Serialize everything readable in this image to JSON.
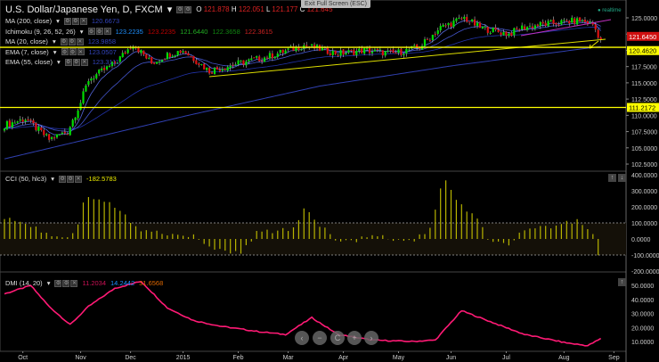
{
  "header": {
    "title": "U.S. Dollar/Japanese Yen, D, FXCM",
    "o_label": "O",
    "o": "121.878",
    "h_label": "H",
    "h": "122.051",
    "l_label": "L",
    "l": "121.177",
    "c_label": "C",
    "c": "121.645",
    "exit_fullscreen": "Exit Full Screen (ESC)",
    "realtime": "realtime"
  },
  "indicators": [
    {
      "name": "MA (200, close)",
      "values": [
        "120.6673"
      ],
      "colors": [
        "#3344bb"
      ]
    },
    {
      "name": "Ichimoku (9, 26, 52, 26)",
      "values": [
        "123.2235",
        "123.2235",
        "121.6440",
        "122.3658",
        "122.3615"
      ],
      "colors": [
        "#1e90ff",
        "#c00000",
        "#22aa22",
        "#118811",
        "#cc2222"
      ]
    },
    {
      "name": "MA (20, close)",
      "values": [
        "123.9858"
      ],
      "colors": [
        "#3344bb"
      ]
    },
    {
      "name": "EMA (7, close)",
      "values": [
        "123.0507"
      ],
      "colors": [
        "#3344bb"
      ]
    },
    {
      "name": "EMA (55, close)",
      "values": [
        "123.3111"
      ],
      "colors": [
        "#3344bb"
      ]
    }
  ],
  "cci": {
    "name": "CCI (50, hlc3)",
    "value": "-182.5783"
  },
  "dmi": {
    "name": "DMI (14, 20)",
    "values": [
      "11.2034",
      "14.2442",
      "31.6568"
    ],
    "colors": [
      "#cc1155",
      "#1e90ff",
      "#dd6600"
    ]
  },
  "price_badges": {
    "last": "121.6450",
    "line1": "120.4620",
    "line2": "111.2172"
  },
  "nav": {
    "left": "‹",
    "zoom_out": "−",
    "reset": "C",
    "zoom_in": "+",
    "right": "›"
  },
  "colors": {
    "up": "#00dd00",
    "down": "#dd1111",
    "hline": "#ffff00",
    "cci": "#b8b400",
    "dmi": "#ff1a75"
  },
  "chart_data": [
    {
      "type": "candlestick",
      "title": "U.S. Dollar/Japanese Yen, D, FXCM",
      "bars": 228,
      "price_axis_ticks": [
        "125.0000",
        "122.5000",
        "120.0000",
        "117.5000",
        "115.0000",
        "112.5000",
        "110.0000",
        "107.5000",
        "105.0000",
        "102.5000"
      ],
      "ylim": [
        101.5,
        126.5
      ],
      "close_path": [
        [
          0,
          108.5
        ],
        [
          8,
          109.5
        ],
        [
          17,
          106.3
        ],
        [
          24,
          107.5
        ],
        [
          29,
          112
        ],
        [
          32,
          115.5
        ],
        [
          42,
          118
        ],
        [
          49,
          121
        ],
        [
          56,
          118
        ],
        [
          63,
          119.5
        ],
        [
          68,
          120
        ],
        [
          78,
          116.8
        ],
        [
          89,
          118
        ],
        [
          100,
          119
        ],
        [
          114,
          120.8
        ],
        [
          127,
          119.5
        ],
        [
          137,
          120
        ],
        [
          148,
          119.5
        ],
        [
          158,
          120.5
        ],
        [
          166,
          123.5
        ],
        [
          175,
          125
        ],
        [
          181,
          123.5
        ],
        [
          192,
          122.5
        ],
        [
          197,
          123.5
        ],
        [
          205,
          124
        ],
        [
          219,
          124.6
        ],
        [
          224,
          124
        ],
        [
          227,
          121.6
        ]
      ],
      "ma200_path": [
        [
          0,
          103.3
        ],
        [
          70,
          110
        ],
        [
          120,
          114.5
        ],
        [
          170,
          117.6
        ],
        [
          227,
          120.6
        ]
      ],
      "horizontal_lines": [
        120.462,
        111.2172
      ]
    },
    {
      "type": "bar",
      "title": "CCI (50, hlc3)",
      "axis_ticks": [
        "400.0000",
        "300.0000",
        "200.0000",
        "100.0000",
        "0.0000",
        "-100.0000",
        "-200.0000"
      ],
      "ylim": [
        -220,
        410
      ],
      "path": [
        [
          0,
          130
        ],
        [
          8,
          100
        ],
        [
          18,
          20
        ],
        [
          25,
          20
        ],
        [
          28,
          100
        ],
        [
          31,
          280
        ],
        [
          40,
          220
        ],
        [
          52,
          60
        ],
        [
          60,
          40
        ],
        [
          74,
          10
        ],
        [
          78,
          -60
        ],
        [
          90,
          -90
        ],
        [
          96,
          40
        ],
        [
          110,
          60
        ],
        [
          114,
          200
        ],
        [
          118,
          120
        ],
        [
          128,
          -30
        ],
        [
          140,
          20
        ],
        [
          155,
          -20
        ],
        [
          162,
          60
        ],
        [
          166,
          300
        ],
        [
          167,
          380
        ],
        [
          172,
          250
        ],
        [
          181,
          100
        ],
        [
          184,
          0
        ],
        [
          192,
          -40
        ],
        [
          197,
          50
        ],
        [
          210,
          80
        ],
        [
          218,
          120
        ],
        [
          224,
          30
        ],
        [
          226,
          -100
        ],
        [
          227,
          -182
        ]
      ]
    },
    {
      "type": "line",
      "title": "DMI (14, 20)",
      "axis_ticks": [
        "50.0000",
        "40.0000",
        "30.0000",
        "20.0000",
        "10.0000"
      ],
      "ylim": [
        2,
        55
      ],
      "path": [
        [
          0,
          44
        ],
        [
          10,
          50
        ],
        [
          17,
          35
        ],
        [
          25,
          22
        ],
        [
          32,
          35
        ],
        [
          42,
          48
        ],
        [
          52,
          53
        ],
        [
          62,
          34
        ],
        [
          72,
          25
        ],
        [
          82,
          21
        ],
        [
          97,
          17
        ],
        [
          107,
          15
        ],
        [
          117,
          27
        ],
        [
          127,
          15
        ],
        [
          140,
          11
        ],
        [
          155,
          10
        ],
        [
          164,
          11
        ],
        [
          174,
          32
        ],
        [
          188,
          22
        ],
        [
          198,
          15
        ],
        [
          214,
          9
        ],
        [
          222,
          7
        ],
        [
          227,
          12
        ]
      ]
    },
    {
      "type": "x-axis",
      "labels": [
        "Oct",
        "Nov",
        "Dec",
        "2015",
        "Feb",
        "Mar",
        "Apr",
        "May",
        "Jun",
        "Jul",
        "Aug",
        "Sep"
      ],
      "label_bars": [
        7,
        29,
        48,
        68,
        89,
        108,
        129,
        150,
        170,
        191,
        213,
        232
      ]
    }
  ]
}
